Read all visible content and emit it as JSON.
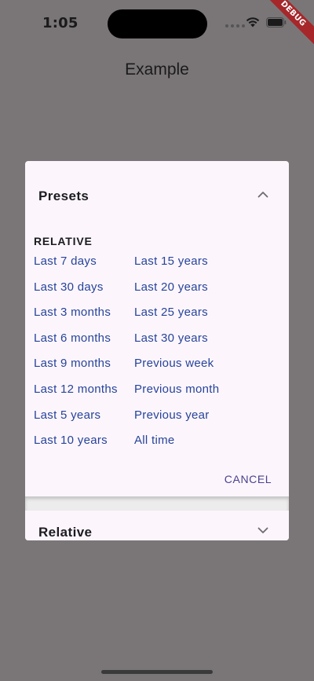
{
  "status_bar": {
    "time": "1:05",
    "icons": [
      "signal-icon",
      "wifi-icon",
      "battery-icon"
    ]
  },
  "debug_banner": "DEBUG",
  "app_bar": {
    "title": "Example"
  },
  "dialog": {
    "presets_title": "Presets",
    "section_label": "RELATIVE",
    "left_column": [
      "Last 7 days",
      "Last 30 days",
      "Last 3 months",
      "Last 6 months",
      "Last 9 months",
      "Last 12 months",
      "Last 5 years",
      "Last 10 years"
    ],
    "right_column": [
      "Last 15 years",
      "Last 20 years",
      "Last 25 years",
      "Last 30 years",
      "Previous week",
      "Previous month",
      "Previous year",
      "All time"
    ],
    "cancel_label": "CANCEL",
    "relative_title": "Relative"
  },
  "colors": {
    "scrim": "#7a7678",
    "dialog_bg": "#fcf6fc",
    "link": "#27439a",
    "button": "#4a3f8e",
    "debug": "#a6262a"
  }
}
